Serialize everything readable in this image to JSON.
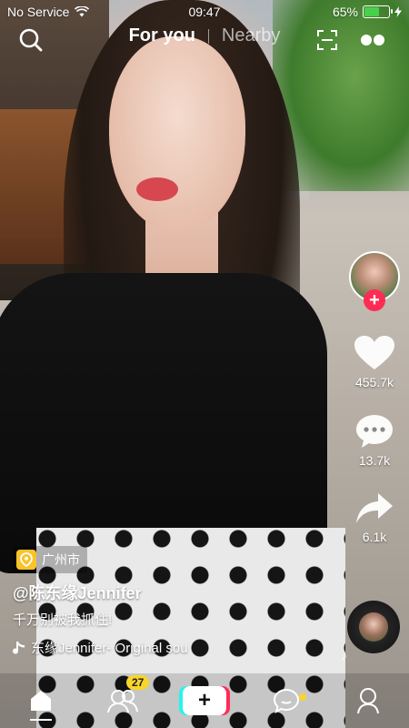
{
  "status_bar": {
    "carrier": "No Service",
    "time": "09:47",
    "battery_percent": "65%",
    "battery_level": 0.65
  },
  "top_nav": {
    "tab_for_you": "For you",
    "tab_nearby": "Nearby"
  },
  "right_rail": {
    "likes": "455.7k",
    "comments": "13.7k",
    "shares": "6.1k"
  },
  "video_info": {
    "location": "广州市",
    "username": "@陈东缘Jennifer",
    "caption": "千万别被我抓住!",
    "music": "东缘Jennifer- Original sou"
  },
  "bottom_nav": {
    "friends_badge": "27"
  },
  "colors": {
    "accent_red": "#fe2c55",
    "accent_cyan": "#25f4ee",
    "badge_yellow": "#f8d52b",
    "battery_green": "#48d04a"
  }
}
